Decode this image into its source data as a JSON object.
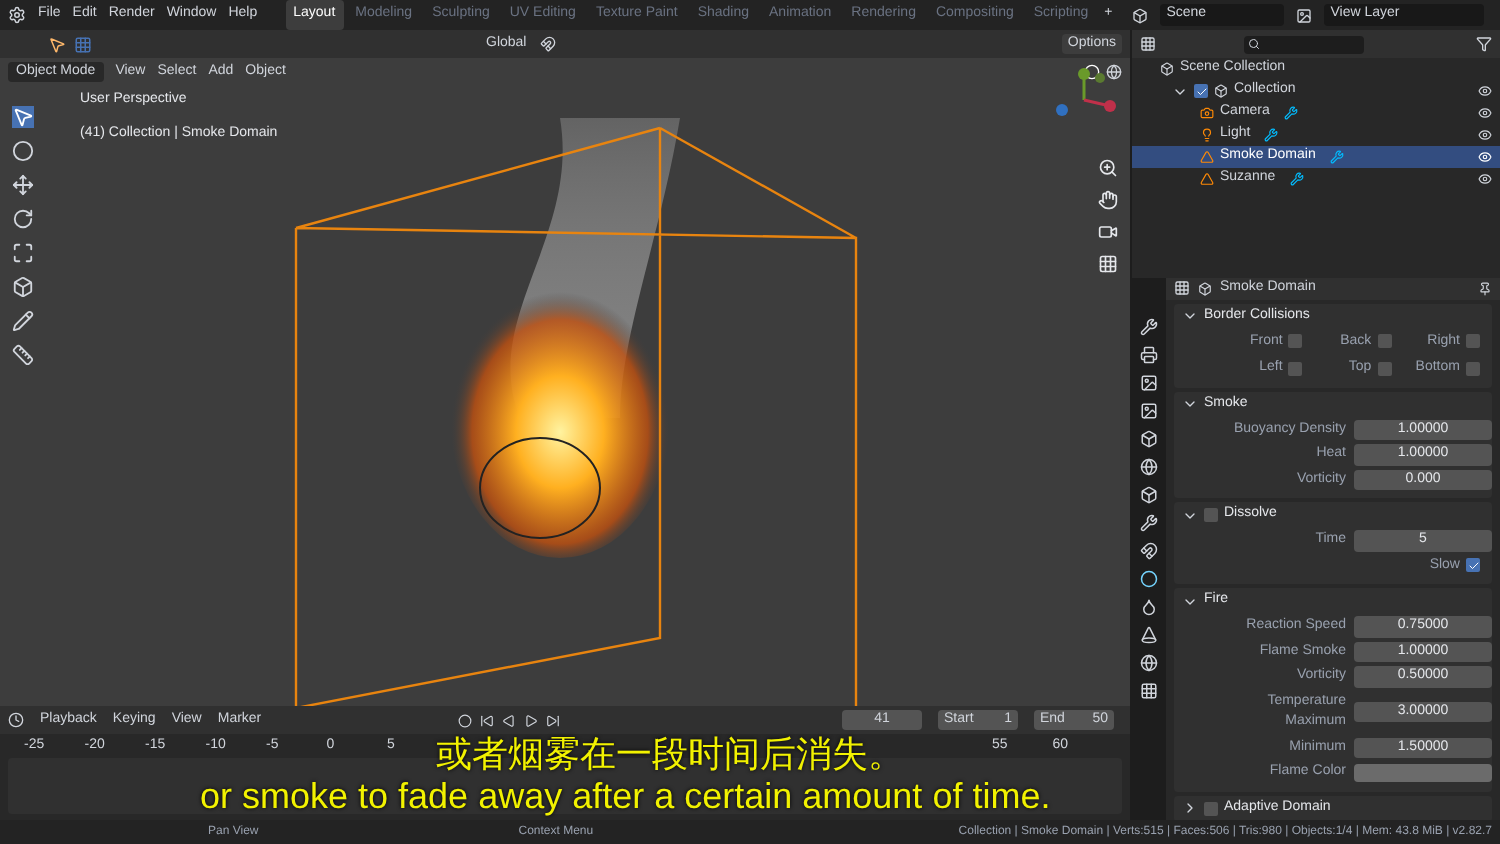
{
  "menu": [
    "File",
    "Edit",
    "Render",
    "Window",
    "Help"
  ],
  "workspaces": [
    {
      "label": "Layout",
      "selected": true
    },
    {
      "label": "Modeling",
      "selected": false
    },
    {
      "label": "Sculpting",
      "selected": false
    },
    {
      "label": "UV Editing",
      "selected": false
    },
    {
      "label": "Texture Paint",
      "selected": false
    },
    {
      "label": "Shading",
      "selected": false
    },
    {
      "label": "Animation",
      "selected": false
    },
    {
      "label": "Rendering",
      "selected": false
    },
    {
      "label": "Compositing",
      "selected": false
    },
    {
      "label": "Scripting",
      "selected": false
    }
  ],
  "add_workspace": "+",
  "scene": "Scene",
  "view_layer": "View Layer",
  "viewport": {
    "orientation": "Global",
    "options": "Options",
    "mode": "Object Mode",
    "menus": [
      "View",
      "Select",
      "Add",
      "Object"
    ],
    "overlay_lines": [
      "User Perspective",
      "(41) Collection | Smoke Domain"
    ]
  },
  "outliner": {
    "root": "Scene Collection",
    "collection": {
      "label": "Collection",
      "checked": true,
      "expanded": true,
      "children": [
        {
          "label": "Camera",
          "selected": false
        },
        {
          "label": "Light",
          "selected": false
        },
        {
          "label": "Smoke Domain",
          "selected": true
        },
        {
          "label": "Suzanne",
          "selected": false
        }
      ]
    }
  },
  "properties": {
    "object": "Smoke Domain",
    "panels": [
      {
        "title": "Border Collisions",
        "expanded": true,
        "rows": [
          {
            "kind": "checkgrid",
            "items": [
              {
                "label": "Front",
                "checked": false
              },
              {
                "label": "Back",
                "checked": false
              },
              {
                "label": "Right",
                "checked": false
              },
              {
                "label": "Left",
                "checked": false
              },
              {
                "label": "Top",
                "checked": false
              },
              {
                "label": "Bottom",
                "checked": false
              }
            ]
          }
        ]
      },
      {
        "title": "Smoke",
        "expanded": true,
        "rows": [
          {
            "kind": "field",
            "label": "Buoyancy Density",
            "value": "1.00000"
          },
          {
            "kind": "field",
            "label": "Heat",
            "value": "1.00000"
          },
          {
            "kind": "field",
            "label": "Vorticity",
            "value": "0.000"
          }
        ]
      },
      {
        "title": "Dissolve",
        "expanded": true,
        "checked": false,
        "rows": [
          {
            "kind": "field",
            "label": "Time",
            "value": "5"
          },
          {
            "kind": "checkbox",
            "label": "Slow",
            "checked": true
          }
        ]
      },
      {
        "title": "Fire",
        "expanded": true,
        "rows": [
          {
            "kind": "field",
            "label": "Reaction Speed",
            "value": "0.75000"
          },
          {
            "kind": "field",
            "label": "Flame Smoke",
            "value": "1.00000"
          },
          {
            "kind": "field",
            "label": "Vorticity",
            "value": "0.50000"
          },
          {
            "kind": "field",
            "label": "Temperature Maximum",
            "value": "3.00000"
          },
          {
            "kind": "field",
            "label": "Minimum",
            "value": "1.50000"
          },
          {
            "kind": "color",
            "label": "Flame Color"
          }
        ]
      },
      {
        "title": "Adaptive Domain",
        "expanded": false,
        "checked": false
      }
    ]
  },
  "timeline": {
    "menus": [
      "Playback",
      "Keying",
      "View",
      "Marker"
    ],
    "current": "41",
    "start_label": "Start",
    "start": "1",
    "end_label": "End",
    "end": "50",
    "ticks": [
      "-25",
      "-20",
      "-15",
      "-10",
      "-5",
      "0",
      "5",
      "55",
      "60"
    ]
  },
  "status": {
    "hints": [
      "Pan View",
      "Context Menu"
    ],
    "stats": "Collection | Smoke Domain | Verts:515 | Faces:506 | Tris:980 | Objects:1/4 | Mem: 43.8 MiB | v2.82.7"
  },
  "subtitles": [
    "或者烟雾在一段时间后消失。",
    "or smoke to fade away after a certain amount of time."
  ]
}
